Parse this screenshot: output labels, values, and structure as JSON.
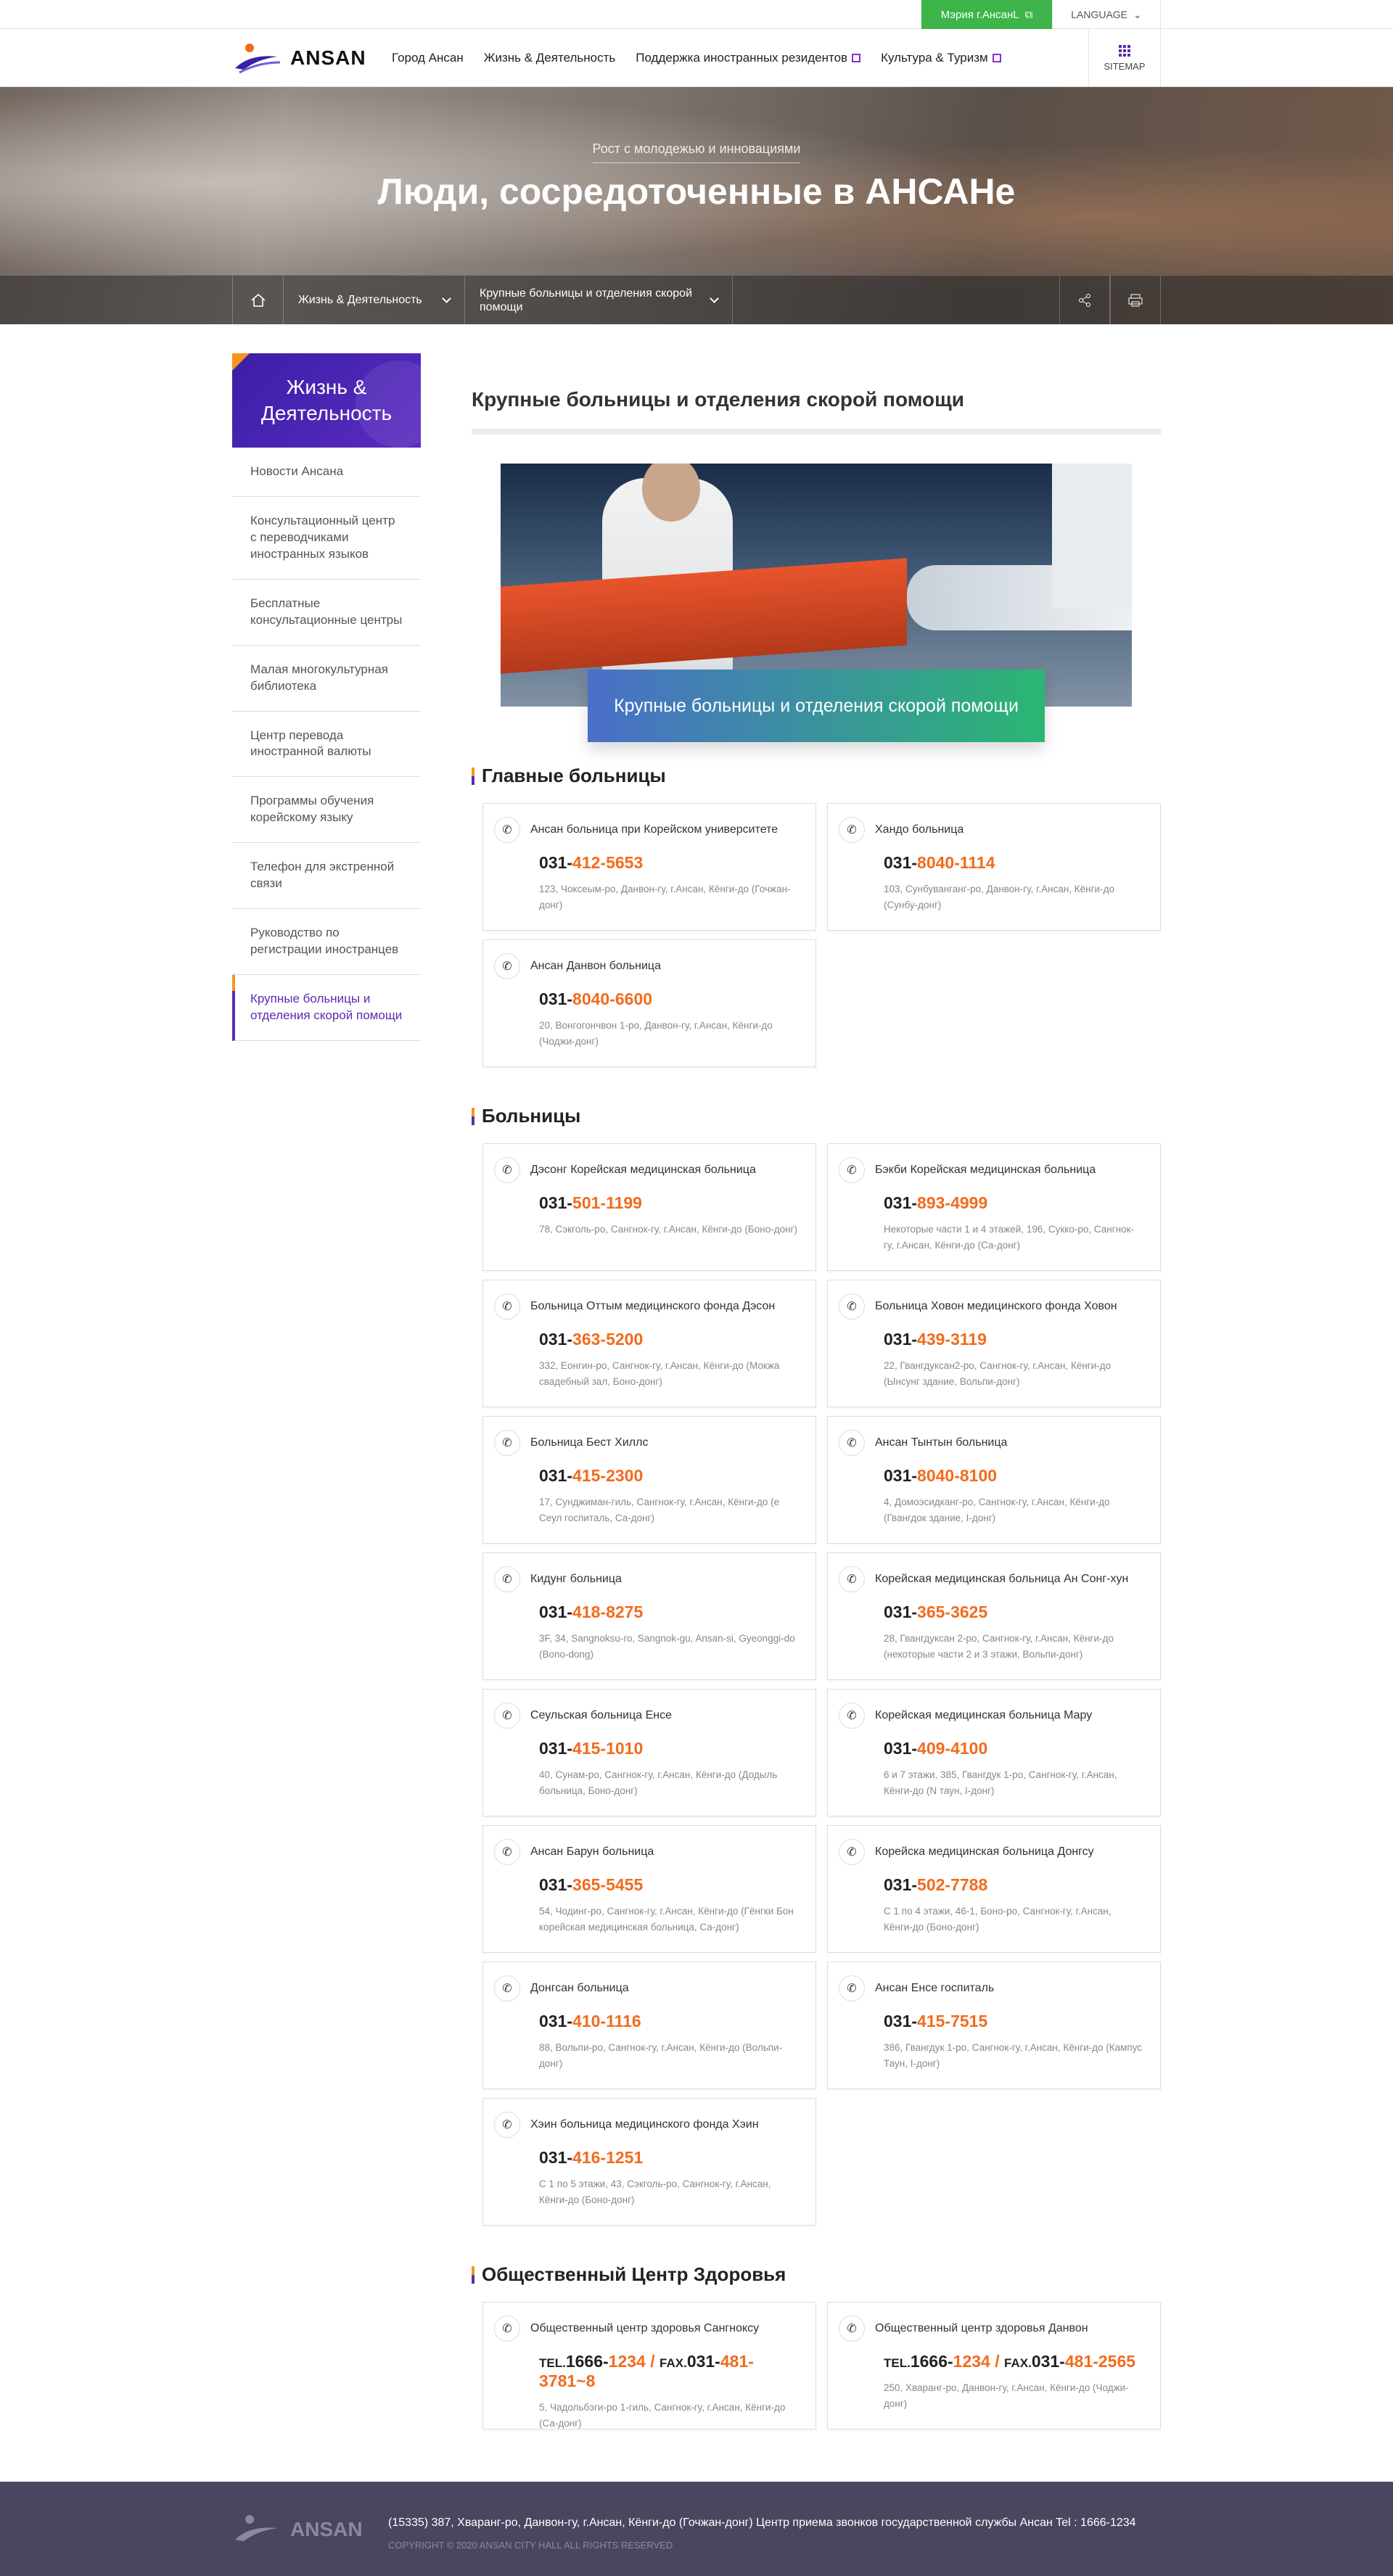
{
  "topbar": {
    "city_hall": "Мэрия г.АнсанL",
    "language": "LANGUAGE"
  },
  "header": {
    "logo": "ANSAN",
    "menu": [
      "Город Ансан",
      "Жизнь & Деятельность",
      "Поддержка иностранных резидентов",
      "Культура & Туризм"
    ],
    "sitemap": "SITEMAP"
  },
  "hero": {
    "subtitle": "Рост с молодежью и инновациями",
    "title": "Люди, сосредоточенные в АНСАНе"
  },
  "breadcrumb": {
    "level1": "Жизнь & Деятельность",
    "level2": "Крупные больницы и отделения скорой помощи"
  },
  "sidebar": {
    "title": "Жизнь & Деятельность",
    "items": [
      "Новости Ансана",
      "Консультационный центр с переводчиками иностранных языков",
      "Бесплатные консультационные центры",
      "Малая многокультурная библиотека",
      "Центр перевода иностранной валюты",
      "Программы обучения корейскому языку",
      "Телефон для экстренной связи",
      "Руководство по регистрации иностранцев",
      "Крупные больницы и отделения скорой помощи"
    ]
  },
  "main": {
    "title": "Крупные больницы и отделения скорой помощи",
    "visual_caption": "Крупные больницы и отделения скорой помощи",
    "sections": [
      {
        "title": "Главные больницы",
        "cards": [
          {
            "name": "Ансан больница при Корейском университете",
            "prefix": "031-",
            "num": "412-5653",
            "addr": "123, Чоксеым-ро, Данвон-гу, г.Ансан, Кёнги-до (Гочжан-донг)"
          },
          {
            "name": "Хандо больница",
            "prefix": "031-",
            "num": "8040-1114",
            "addr": "103, Сунбуванганг-ро, Данвон-гу, г.Ансан, Кёнги-до (Сунбу-донг)"
          },
          {
            "name": "Ансан Данвон больница",
            "prefix": "031-",
            "num": "8040-6600",
            "addr": "20, Вонгогончвон 1-ро, Данвон-гу, г.Ансан, Кёнги-до (Чоджи-донг)"
          }
        ]
      },
      {
        "title": "Больницы",
        "cards": [
          {
            "name": "Дэсонг Корейская медицинская больница",
            "prefix": "031-",
            "num": "501-1199",
            "addr": "78, Сэкголь-ро, Сангнок-гу, г.Ансан, Кёнги-до (Боно-донг)"
          },
          {
            "name": "Бэкби Корейская медицинская больница",
            "prefix": "031-",
            "num": "893-4999",
            "addr": "Некоторые части 1 и 4 этажей, 196, Сукко-ро, Сангнок-гу, г.Ансан, Кёнги-до (Са-донг)"
          },
          {
            "name": "Больница Оттым медицинского фонда Дэсон",
            "prefix": "031-",
            "num": "363-5200",
            "addr": "332, Еонгин-ро, Сангнок-гу, г.Ансан, Кёнги-до (Мокжа свадебный зал, Боно-донг)"
          },
          {
            "name": "Больница Ховон медицинского фонда Ховон",
            "prefix": "031-",
            "num": "439-3119",
            "addr": "22, Гвангдуксан2-ро, Сангнок-гу, г.Ансан, Кёнги-до (Ынсунг здание, Вольпи-донг)"
          },
          {
            "name": "Больница Бест Хиллс",
            "prefix": "031-",
            "num": "415-2300",
            "addr": "17, Сунджиман-гиль, Сангнок-гу, г.Ансан, Кёнги-до (е Сеул госпиталь, Са-донг)"
          },
          {
            "name": "Ансан Тынтын больница",
            "prefix": "031-",
            "num": "8040-8100",
            "addr": "4, Домоэсидканг-ро, Сангнок-гу, г.Ансан, Кёнги-до (Гвангдок здание, I-донг)"
          },
          {
            "name": "Кидунг больница",
            "prefix": "031-",
            "num": "418-8275",
            "addr": "3F, 34, Sangnoksu-ro, Sangnok-gu, Ansan-si, Gyeonggi-do (Bono-dong)"
          },
          {
            "name": "Корейская медицинская больница Ан Сонг-хун",
            "prefix": "031-",
            "num": "365-3625",
            "addr": "28, Гвангдуксан 2-ро, Сангнок-гу, г.Ансан, Кёнги-до (некоторые части 2 и 3 этажи, Вольпи-донг)"
          },
          {
            "name": "Сеульская больница Енсе",
            "prefix": "031-",
            "num": "415-1010",
            "addr": "40, Сунам-ро, Сангнок-гу, г.Ансан, Кёнги-до (Додыль больница, Боно-донг)"
          },
          {
            "name": "Корейская медицинская больница Мару",
            "prefix": "031-",
            "num": "409-4100",
            "addr": "6 и 7 этажи, 385, Гвангдук 1-ро, Сангнок-гу, г.Ансан, Кёнги-до (N таун, I-донг)"
          },
          {
            "name": "Ансан Барун больница",
            "prefix": "031-",
            "num": "365-5455",
            "addr": "54, Чодинг-ро, Сангнок-гу, г.Ансан, Кёнги-до (Гёнгки Бон корейская медицинская больница, Са-донг)"
          },
          {
            "name": "Корейска медицинская больница Донгсу",
            "prefix": "031-",
            "num": "502-7788",
            "addr": "С 1 по 4 этажи, 46-1, Боно-ро, Сангнок-гу, г.Ансан, Кёнги-до (Боно-донг)"
          },
          {
            "name": "Донгсан больница",
            "prefix": "031-",
            "num": "410-1116",
            "addr": "88, Вольпи-ро, Сангнок-гу, г.Ансан, Кёнги-до (Вольпи-донг)"
          },
          {
            "name": "Ансан Енсе госпиталь",
            "prefix": "031-",
            "num": "415-7515",
            "addr": "386, Гвангдук 1-ро, Сангнок-гу, г.Ансан, Кёнги-до (Кампус Таун, I-донг)"
          },
          {
            "name": "Хэин больница медицинского фонда Хэин",
            "prefix": "031-",
            "num": "416-1251",
            "addr": "С 1 по 5 этажи, 43, Сэкголь-ро, Сангнок-гу, г.Ансан, Кёнги-до (Боно-донг)"
          }
        ]
      },
      {
        "title": "Общественный Центр Здоровья",
        "cards": [
          {
            "name": "Общественный центр здоровья Сангноксу",
            "tel_label": "TEL.",
            "tel_prefix": "1666-",
            "tel_num": "1234",
            "sep": " / ",
            "fax_label": "FAX.",
            "fax_prefix": "031-",
            "fax_num": "481-3781~8",
            "addr": "5, Чадольбэги-ро 1-гиль, Сангнок-гу, г.Ансан, Кёнги-до (Са-донг)"
          },
          {
            "name": "Общественный центр здоровья Данвон",
            "tel_label": "TEL.",
            "tel_prefix": "1666-",
            "tel_num": "1234",
            "sep": " / ",
            "fax_label": "FAX.",
            "fax_prefix": "031-",
            "fax_num": "481-2565",
            "addr": "250, Хваранг-ро, Данвон-гу, г.Ансан, Кёнги-до (Чоджи-донг)"
          }
        ]
      }
    ]
  },
  "footer": {
    "logo": "ANSAN",
    "address": "(15335) 387, Хваранг-ро, Данвон-гу, г.Ансан, Кёнги-до (Гочжан-донг) Центр приема звонков государственной службы Ансан     Tel : 1666-1234",
    "copyright": "COPYRIGHT © 2020 ANSAN CITY HALL ALL RIGHTS RESERVED"
  },
  "colors": {
    "accent_purple": "#5b2bb0",
    "accent_orange": "#f26b1d",
    "city_green": "#3db54a",
    "footer_bg": "#4b4560"
  },
  "icons": {
    "home": "home-icon",
    "share": "share-icon",
    "print": "print-icon",
    "phone": "phone-icon",
    "external": "external-link-icon"
  }
}
